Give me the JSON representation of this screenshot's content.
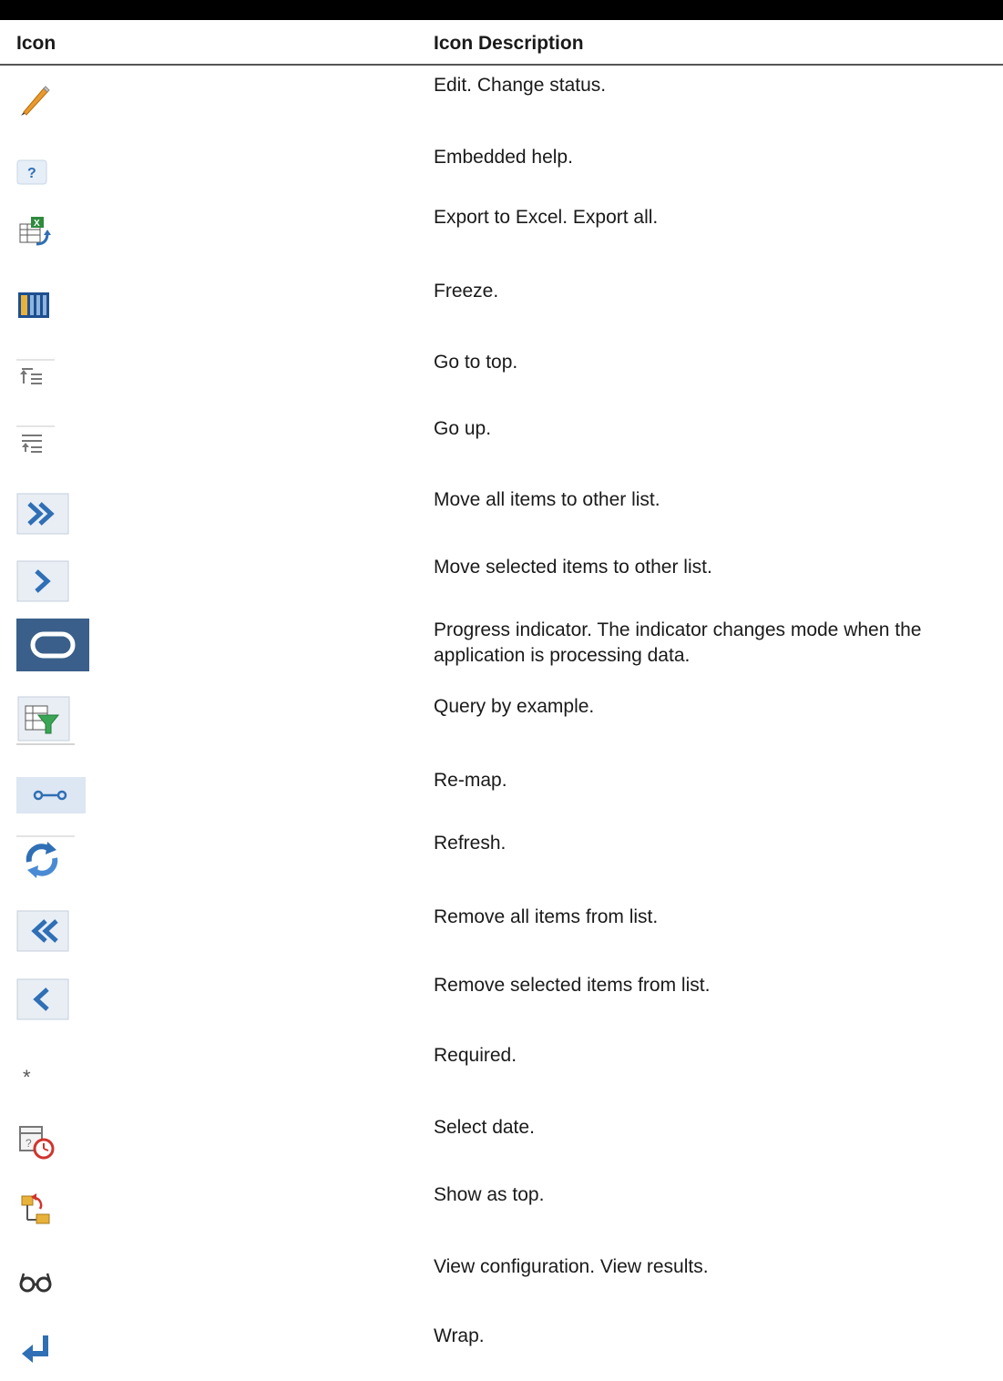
{
  "header": {
    "icon_col": "Icon",
    "desc_col": "Icon Description"
  },
  "rows": [
    {
      "icon": "pencil-icon",
      "desc": "Edit. Change status."
    },
    {
      "icon": "help-icon",
      "desc": "Embedded help."
    },
    {
      "icon": "excel-export-icon",
      "desc": "Export to Excel. Export all."
    },
    {
      "icon": "freeze-icon",
      "desc": "Freeze."
    },
    {
      "icon": "go-to-top-icon",
      "desc": "Go to top."
    },
    {
      "icon": "go-up-icon",
      "desc": "Go up."
    },
    {
      "icon": "double-chevron-right-icon",
      "desc": "Move all items to other list."
    },
    {
      "icon": "chevron-right-icon",
      "desc": "Move selected items to other list."
    },
    {
      "icon": "progress-indicator-icon",
      "desc": "Progress indicator. The indicator changes mode when the application is processing data."
    },
    {
      "icon": "query-by-example-icon",
      "desc": "Query by example."
    },
    {
      "icon": "remap-icon",
      "desc": "Re-map."
    },
    {
      "icon": "refresh-icon",
      "desc": "Refresh."
    },
    {
      "icon": "double-chevron-left-icon",
      "desc": "Remove all items from list."
    },
    {
      "icon": "chevron-left-icon",
      "desc": "Remove selected items from list."
    },
    {
      "icon": "required-asterisk-icon",
      "desc": "Required."
    },
    {
      "icon": "select-date-icon",
      "desc": "Select date."
    },
    {
      "icon": "show-as-top-icon",
      "desc": "Show as top."
    },
    {
      "icon": "glasses-icon",
      "desc": "View configuration. View results."
    },
    {
      "icon": "wrap-icon",
      "desc": "Wrap."
    }
  ],
  "colors": {
    "accent_blue": "#2f6fb5",
    "progress_bg": "#3a5f8a",
    "pencil_orange": "#e89a2c"
  }
}
